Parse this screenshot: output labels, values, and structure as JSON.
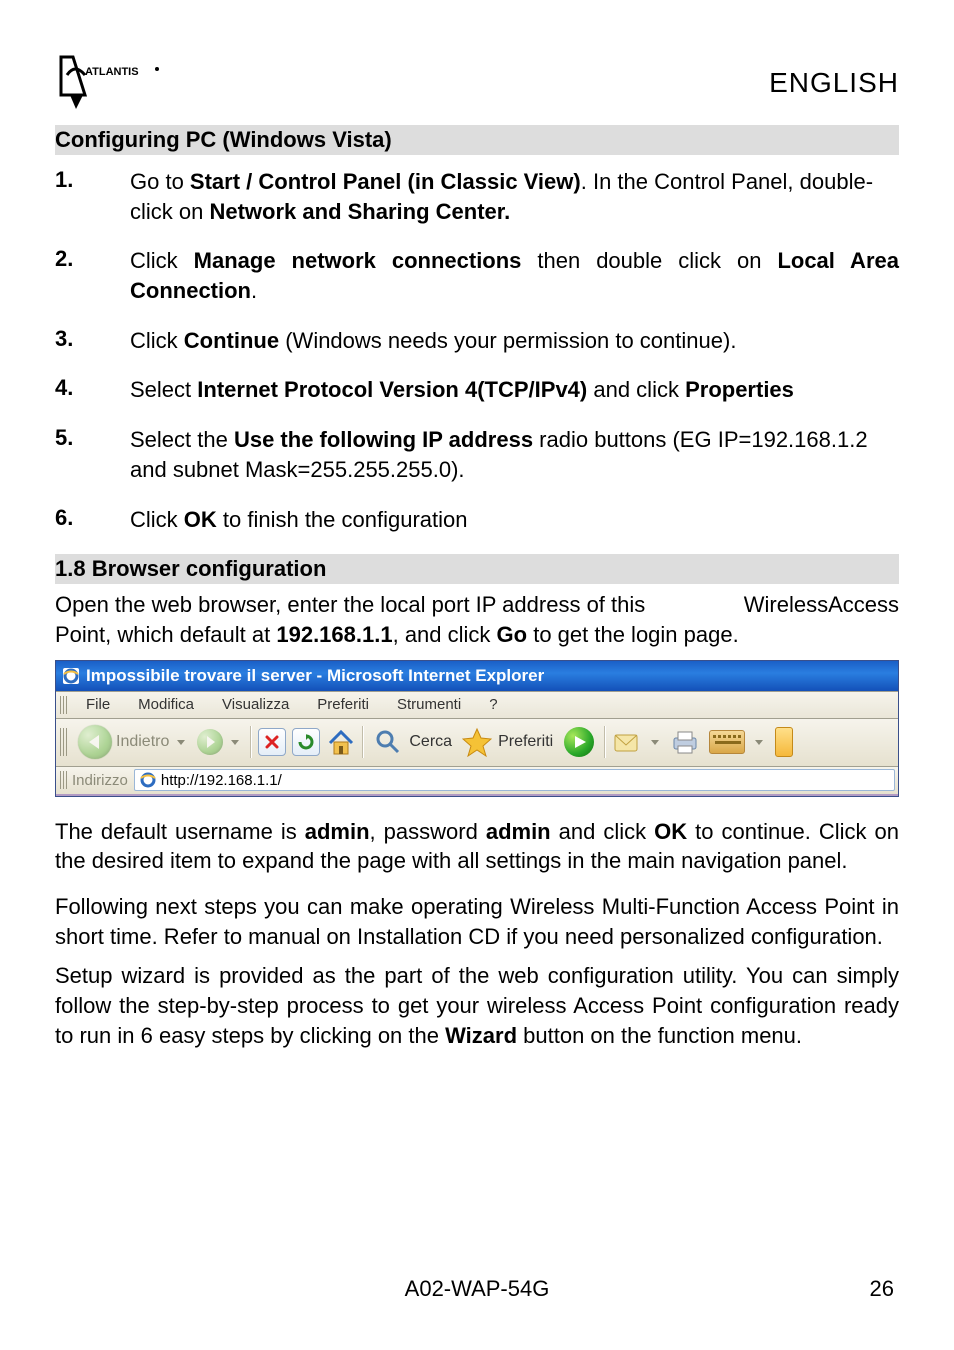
{
  "header": {
    "logo_text": "ATLANTIS",
    "lang": "ENGLISH"
  },
  "heading1": "Configuring   PC (Windows Vista)",
  "steps": [
    {
      "n": "1.",
      "parts": [
        "Go to ",
        "Start / Control Panel (in Classic View)",
        ". In the Control Panel, double-click on ",
        "Network and Sharing Center.",
        ""
      ]
    },
    {
      "n": "2.",
      "parts": [
        "Click ",
        "Manage network connections",
        " then double click on ",
        "Local Area Connection",
        "."
      ]
    },
    {
      "n": "3.",
      "parts": [
        "Click ",
        "Continue",
        " (Windows needs your permission to continue).",
        "",
        ""
      ]
    },
    {
      "n": "4.",
      "parts": [
        "Select ",
        "Internet Protocol Version 4(TCP/IPv4)",
        " and click ",
        "Properties",
        ""
      ]
    },
    {
      "n": "5.",
      "parts": [
        "Select the ",
        "Use the following IP address",
        " radio buttons (EG IP=192.168.1.2 and subnet Mask=255.255.255.0).",
        "",
        ""
      ]
    },
    {
      "n": "6.",
      "parts": [
        "Click ",
        "OK",
        " to finish the configuration",
        "",
        ""
      ]
    }
  ],
  "heading2": "1.8 Browser configuration",
  "intro": {
    "part1": "Open the web browser, enter the local port IP address of this",
    "part1b": "WirelessAccess Point, which default at ",
    "ip": "192.168.1.1",
    "part2": ", and click ",
    "go": "Go",
    "part3": " to get the login page."
  },
  "browser": {
    "title": "Impossibile trovare il server - Microsoft Internet Explorer",
    "menus": [
      "File",
      "Modifica",
      "Visualizza",
      "Preferiti",
      "Strumenti",
      "?"
    ],
    "toolbar": {
      "back_label": "Indietro",
      "search_label": "Cerca",
      "fav_label": "Preferiti"
    },
    "address_label": "Indirizzo",
    "address_value": "http://192.168.1.1/"
  },
  "body_paras": {
    "p1a": "The default username is ",
    "p1_admin1": "admin",
    "p1b": ", password ",
    "p1_admin2": "admin",
    "p1c": " and click ",
    "p1_ok": "OK",
    "p1d": " to continue. Click on the desired item to expand the page with all settings in the main navigation panel.",
    "p2": "Following next steps you can make operating Wireless Multi-Function Access Point in short time.  Refer to manual on Installation CD if you need personalized configuration.",
    "p3a": "Setup wizard is provided as the part of the web configuration utility. You can simply follow the step-by-step process to get your wireless Access Point configuration ready to run in 6 easy steps by clicking on the ",
    "p3_wiz": "Wizard",
    "p3b": " button on the function menu."
  },
  "footer": {
    "model": "A02-WAP-54G",
    "page": "26"
  }
}
